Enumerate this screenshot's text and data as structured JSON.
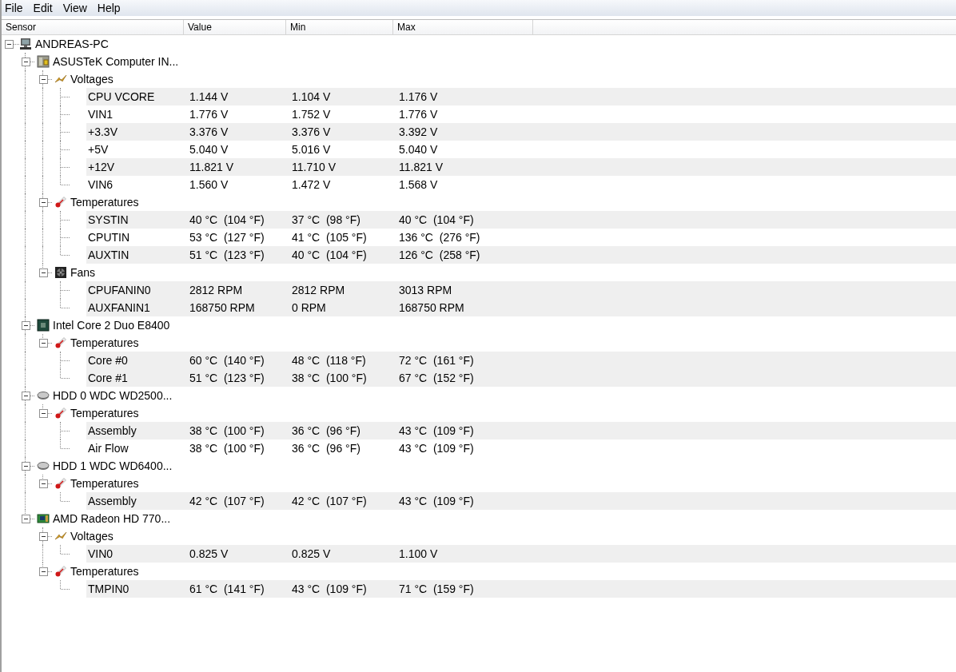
{
  "menu": [
    "File",
    "Edit",
    "View",
    "Help"
  ],
  "columns": [
    "Sensor",
    "Value",
    "Min",
    "Max"
  ],
  "tree": {
    "name": "ANDREAS-PC",
    "expanded": true,
    "devices": [
      {
        "name": "ASUSTeK Computer IN...",
        "kind": "motherboard",
        "expanded": true,
        "groups": [
          {
            "name": "Voltages",
            "kind": "voltage",
            "expanded": true,
            "sensors": [
              {
                "name": "CPU VCORE",
                "value": "1.144 V",
                "min": "1.104 V",
                "max": "1.176 V",
                "shaded": true
              },
              {
                "name": "VIN1",
                "value": "1.776 V",
                "min": "1.752 V",
                "max": "1.776 V",
                "shaded": false
              },
              {
                "name": "+3.3V",
                "value": "3.376 V",
                "min": "3.376 V",
                "max": "3.392 V",
                "shaded": true
              },
              {
                "name": "+5V",
                "value": "5.040 V",
                "min": "5.016 V",
                "max": "5.040 V",
                "shaded": false
              },
              {
                "name": "+12V",
                "value": "11.821 V",
                "min": "11.710 V",
                "max": "11.821 V",
                "shaded": true
              },
              {
                "name": "VIN6",
                "value": "1.560 V",
                "min": "1.472 V",
                "max": "1.568 V",
                "shaded": false
              }
            ]
          },
          {
            "name": "Temperatures",
            "kind": "temperature",
            "expanded": true,
            "sensors": [
              {
                "name": "SYSTIN",
                "value": "40 °C  (104 °F)",
                "min": "37 °C  (98 °F)",
                "max": "40 °C  (104 °F)",
                "shaded": true
              },
              {
                "name": "CPUTIN",
                "value": "53 °C  (127 °F)",
                "min": "41 °C  (105 °F)",
                "max": "136 °C  (276 °F)",
                "shaded": false
              },
              {
                "name": "AUXTIN",
                "value": "51 °C  (123 °F)",
                "min": "40 °C  (104 °F)",
                "max": "126 °C  (258 °F)",
                "shaded": true
              }
            ]
          },
          {
            "name": "Fans",
            "kind": "fan",
            "expanded": true,
            "sensors": [
              {
                "name": "CPUFANIN0",
                "value": "2812 RPM",
                "min": "2812 RPM",
                "max": "3013 RPM",
                "shaded": true
              },
              {
                "name": "AUXFANIN1",
                "value": "168750 RPM",
                "min": "0 RPM",
                "max": "168750 RPM",
                "shaded": true
              }
            ]
          }
        ]
      },
      {
        "name": "Intel Core 2 Duo E8400",
        "kind": "cpu",
        "expanded": true,
        "groups": [
          {
            "name": "Temperatures",
            "kind": "temperature",
            "expanded": true,
            "sensors": [
              {
                "name": "Core #0",
                "value": "60 °C  (140 °F)",
                "min": "48 °C  (118 °F)",
                "max": "72 °C  (161 °F)",
                "shaded": true
              },
              {
                "name": "Core #1",
                "value": "51 °C  (123 °F)",
                "min": "38 °C  (100 °F)",
                "max": "67 °C  (152 °F)",
                "shaded": true
              }
            ]
          }
        ]
      },
      {
        "name": "HDD 0 WDC WD2500...",
        "kind": "hdd",
        "expanded": true,
        "groups": [
          {
            "name": "Temperatures",
            "kind": "temperature",
            "expanded": true,
            "sensors": [
              {
                "name": "Assembly",
                "value": "38 °C  (100 °F)",
                "min": "36 °C  (96 °F)",
                "max": "43 °C  (109 °F)",
                "shaded": true
              },
              {
                "name": "Air Flow",
                "value": "38 °C  (100 °F)",
                "min": "36 °C  (96 °F)",
                "max": "43 °C  (109 °F)",
                "shaded": false
              }
            ]
          }
        ]
      },
      {
        "name": "HDD 1 WDC WD6400...",
        "kind": "hdd",
        "expanded": true,
        "groups": [
          {
            "name": "Temperatures",
            "kind": "temperature",
            "expanded": true,
            "sensors": [
              {
                "name": "Assembly",
                "value": "42 °C  (107 °F)",
                "min": "42 °C  (107 °F)",
                "max": "43 °C  (109 °F)",
                "shaded": true
              }
            ]
          }
        ]
      },
      {
        "name": "AMD Radeon HD 770...",
        "kind": "gpu",
        "expanded": true,
        "groups": [
          {
            "name": "Voltages",
            "kind": "voltage",
            "expanded": true,
            "sensors": [
              {
                "name": "VIN0",
                "value": "0.825 V",
                "min": "0.825 V",
                "max": "1.100 V",
                "shaded": true
              }
            ]
          },
          {
            "name": "Temperatures",
            "kind": "temperature",
            "expanded": true,
            "sensors": [
              {
                "name": "TMPIN0",
                "value": "61 °C  (141 °F)",
                "min": "43 °C  (109 °F)",
                "max": "71 °C  (159 °F)",
                "shaded": true
              }
            ]
          }
        ]
      }
    ]
  }
}
